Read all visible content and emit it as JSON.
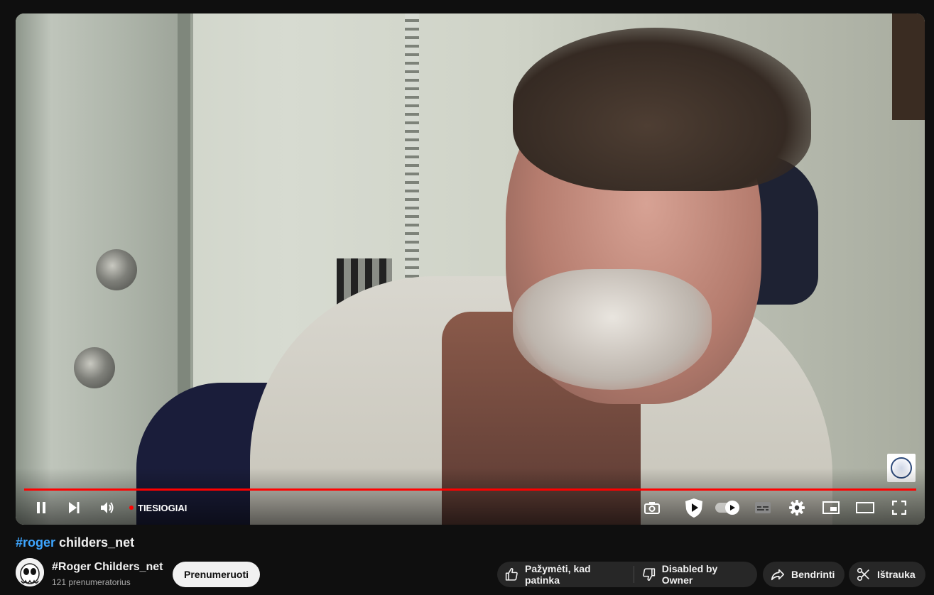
{
  "video": {
    "live_label": "TIESIOGIAI",
    "progress": 1.0,
    "controls": {
      "play_pause": "pause-icon",
      "next": "next-icon",
      "volume": "volume-icon",
      "screenshot": "camera-icon",
      "shield": "shield-play-icon",
      "autoplay": "autoplay-toggle",
      "subtitles": "subtitles-icon",
      "settings": "gear-icon",
      "miniplayer": "miniplayer-icon",
      "theater": "theater-mode-icon",
      "fullscreen": "fullscreen-icon"
    }
  },
  "title": {
    "hashtag": "#roger",
    "text": " childers_net"
  },
  "channel": {
    "name": "#Roger Childers_net",
    "subscribers": "121 prenumeratorius",
    "subscribe_label": "Prenumeruoti"
  },
  "actions": {
    "like_label": "Pažymėti, kad patinka",
    "dislike_label": "Disabled by Owner",
    "share_label": "Bendrinti",
    "clip_label": "Ištrauka"
  },
  "colors": {
    "background": "#0f0f0f",
    "accent_red": "#ff0000",
    "hashtag_blue": "#3ea6ff",
    "pill_bg": "#272727"
  }
}
